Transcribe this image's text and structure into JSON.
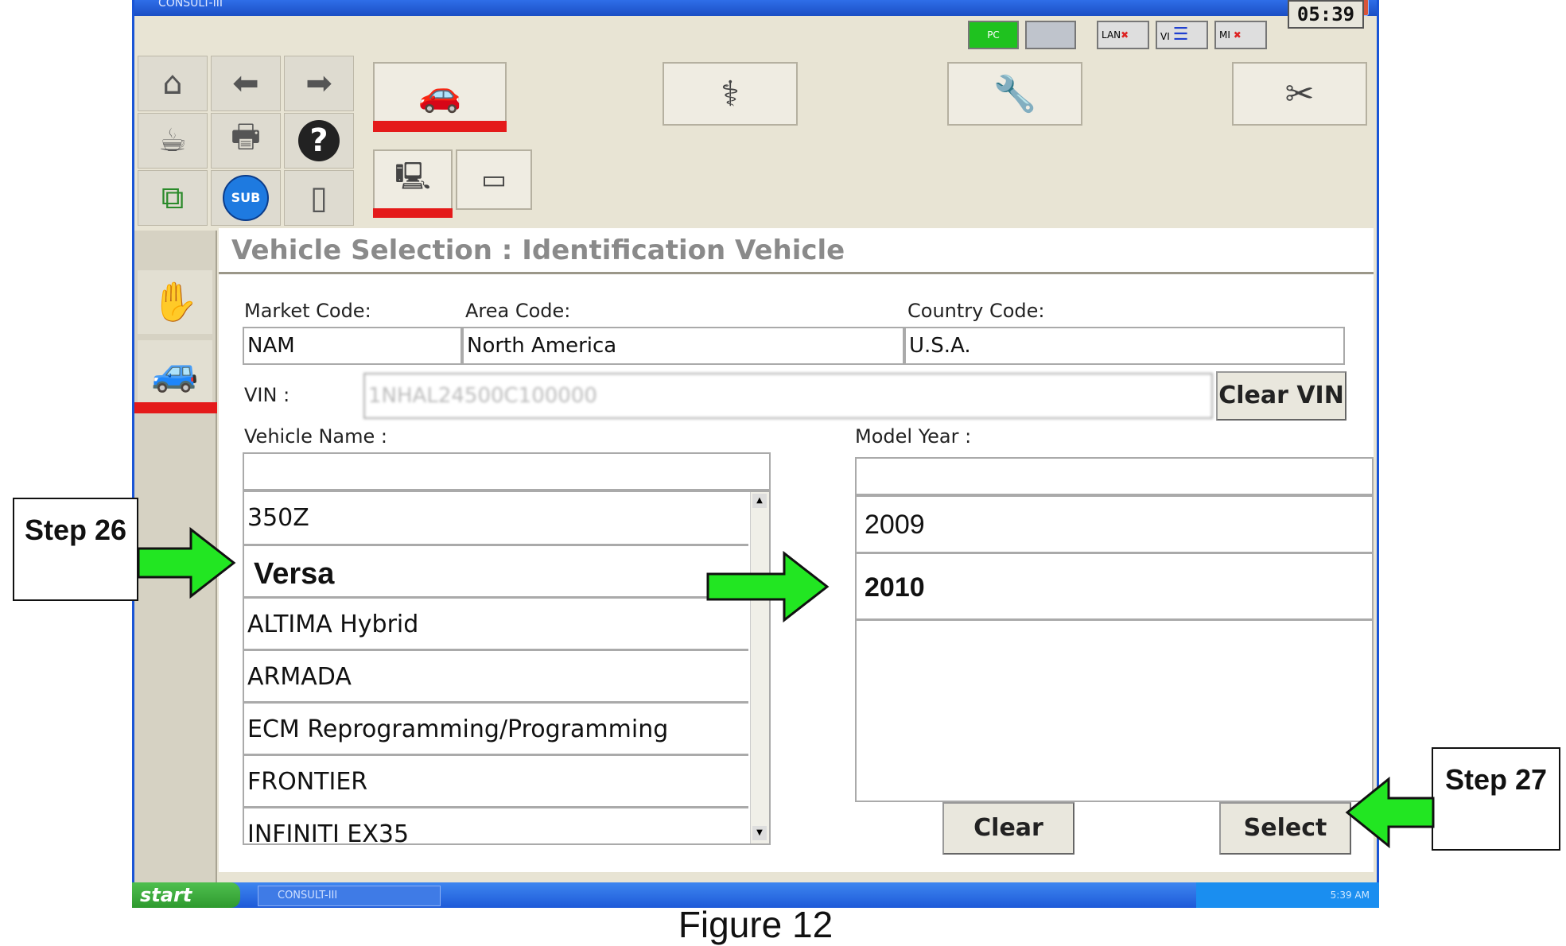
{
  "window": {
    "title": "CONSULT-III"
  },
  "status": {
    "pc_label": "PC",
    "lan_label": "LAN",
    "vi_label": "VI",
    "mi_label": "MI",
    "clock": "05:39"
  },
  "toolbar": {
    "home_icon": "home-icon",
    "back_icon": "arrow-left-icon",
    "forward_icon": "arrow-right-icon",
    "help_symbol": "?",
    "sub_label": "SUB"
  },
  "page": {
    "heading": "Vehicle Selection : Identification Vehicle"
  },
  "form": {
    "market_code_label": "Market Code:",
    "market_code_value": "NAM",
    "area_code_label": "Area Code:",
    "area_code_value": "North America",
    "country_code_label": "Country Code:",
    "country_code_value": "U.S.A.",
    "vin_label": "VIN :",
    "vin_value": "1NHAL24500C100000",
    "clear_vin_label": "Clear VIN",
    "vehicle_name_label": "Vehicle Name :",
    "model_year_label": "Model Year :"
  },
  "vehicle_list": [
    "350Z",
    "Versa",
    "ALTIMA Hybrid",
    "ARMADA",
    "ECM Reprogramming/Programming",
    "FRONTIER",
    "INFINITI EX35"
  ],
  "model_year_list": [
    "2009",
    "2010"
  ],
  "buttons": {
    "clear_label": "Clear",
    "select_label": "Select"
  },
  "taskbar": {
    "start_label": "start",
    "app_label": "CONSULT-III",
    "tray_time": "5:39 AM"
  },
  "callouts": {
    "step26": "Step 26",
    "step27": "Step 27"
  },
  "caption": "Figure 12",
  "colors": {
    "arrow": "#22e622",
    "accent_red": "#e41a1a",
    "title_blue": "#1a55d6"
  }
}
